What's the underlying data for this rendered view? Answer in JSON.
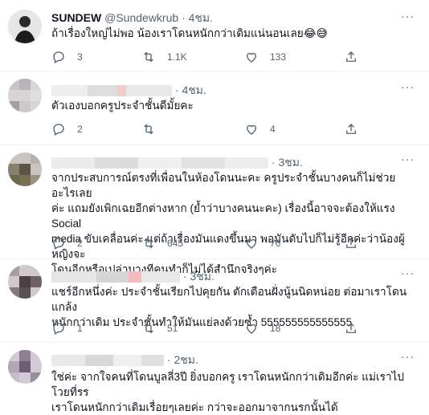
{
  "tweets": [
    {
      "name": "SUNDEW",
      "handle": "@Sundewkrub",
      "time": "· 4ชม.",
      "text": "ถ้าเรื่องใหญ่ไม่พอ น้องเราโดนหนักกว่าเดิมแน่นอนเลย😂😅",
      "replies": "3",
      "retweets": "1.1K",
      "likes": "133"
    },
    {
      "time": "· 4ชม.",
      "text": "ตัวเองบอกครูประจำชั้นดีมั้ยคะ",
      "replies": "2",
      "retweets": "",
      "likes": "4"
    },
    {
      "time": "· 3ชม.",
      "text_lines": [
        "จากประสบการณ์ตรงที่เพื่อนในห้องโดนนะคะ ครูประจำชั้นบางคนก็ไม่ช่วยอะไรเลย",
        "ค่ะ แถมยังเพิกเฉยอีกต่างหาก (ย้ำว่าบางคนนะคะ) เรื่องนี้อาจจะต้องให้แรง Social",
        "media ขับเคลื่อนค่ะ แต่ถ้าเรื่องมันแดงขึ้นมา พอมันดับไปก็ไม่รู้อีกค่ะว่าน้องผู้หญิงจะ",
        "โดนอีกหรือเปล่าบางทีคนทำก็ไม่ได้สำนึกจริงๆค่ะ"
      ],
      "replies": "2",
      "retweets": "645",
      "likes": "76"
    },
    {
      "time": "· 3ชม.",
      "text_lines": [
        "แชร์อีกหนึ่งค่ะ ประจำชั้นเรียกไปคุยกัน ตักเตือนฝั่งนู้นนิดหน่อย ต่อมาเราโดนแกล้ง",
        "หนักกว่าเดิม ประจำชั้นทำให้มันแย่ลงด้วยซ้ำ 555555555555555"
      ],
      "replies": "1",
      "retweets": "51",
      "likes": "18"
    },
    {
      "time": "· 2ชม.",
      "text_lines": [
        "ใช่ค่ะ จากใจคนที่โดนบูลลี่3ปี ยิ่งบอกครู เราโดนหนักกว่าเดิมอีกค่ะ แม่เราไปโวยที่รร",
        "เราโดนหนักกว่าเดิมเรื่อยๆเลยค่ะ กว่าจะออกมาจากนรกนั้นได้"
      ]
    }
  ],
  "more_label": "···",
  "icon_names": [
    "reply-icon",
    "retweet-icon",
    "like-icon",
    "share-icon"
  ]
}
